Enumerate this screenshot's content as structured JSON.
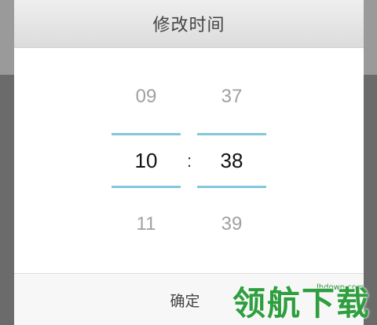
{
  "dialog": {
    "title": "修改时间",
    "confirm_label": "确定"
  },
  "picker": {
    "hour": {
      "prev": "09",
      "current": "10",
      "next": "11"
    },
    "minute": {
      "prev": "37",
      "current": "38",
      "next": "39"
    },
    "separator": ":"
  },
  "watermark": {
    "url": "lhdown.com",
    "logo_text": "领航下载"
  },
  "colors": {
    "accent_line": "#86c7dc",
    "watermark_green": "#2f9e3f"
  }
}
